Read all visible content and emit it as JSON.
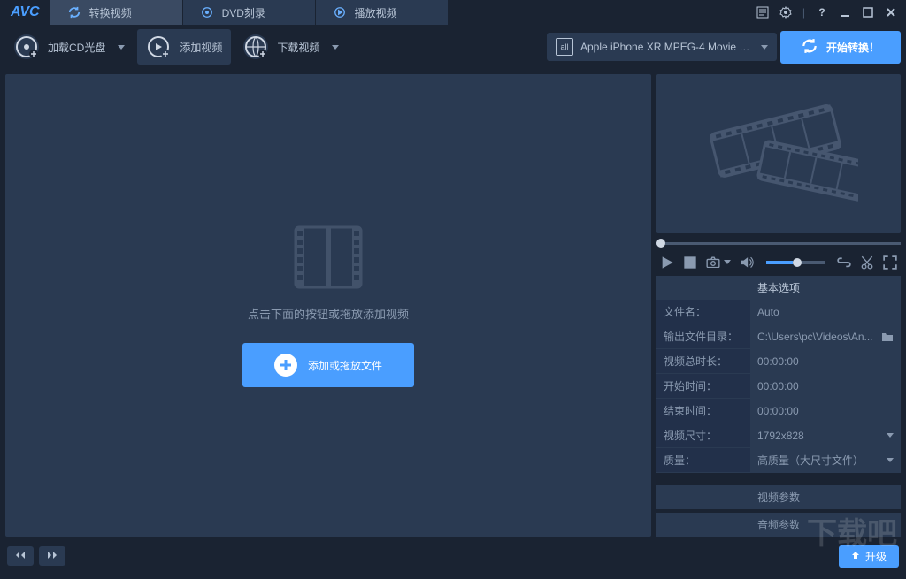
{
  "app": {
    "logo": "AVC"
  },
  "tabs": [
    {
      "label": "转换视频",
      "icon": "refresh"
    },
    {
      "label": "DVD刻录",
      "icon": "disc"
    },
    {
      "label": "播放视频",
      "icon": "play"
    }
  ],
  "toolbar": {
    "load_cd": "加载CD光盘",
    "add_video": "添加视频",
    "download_video": "下载视频",
    "profile": "Apple iPhone XR MPEG-4 Movie (*.m...",
    "start": "开始转换！"
  },
  "canvas": {
    "hint": "点击下面的按钮或拖放添加视频",
    "add_label": "添加或拖放文件"
  },
  "props": {
    "header": "基本选项",
    "rows": {
      "filename": {
        "label": "文件名：",
        "value": "Auto"
      },
      "outdir": {
        "label": "输出文件目录：",
        "value": "C:\\Users\\pc\\Videos\\An..."
      },
      "total": {
        "label": "视频总时长：",
        "value": "00:00:00"
      },
      "start": {
        "label": "开始时间：",
        "value": "00:00:00"
      },
      "end": {
        "label": "结束时间：",
        "value": "00:00:00"
      },
      "size": {
        "label": "视频尺寸：",
        "value": "1792x828"
      },
      "quality": {
        "label": "质量：",
        "value": "高质量（大尺寸文件）"
      }
    },
    "acc_video": "视频参数",
    "acc_audio": "音频参数"
  },
  "bottom": {
    "upgrade": "升级"
  },
  "watermark": "下载吧"
}
